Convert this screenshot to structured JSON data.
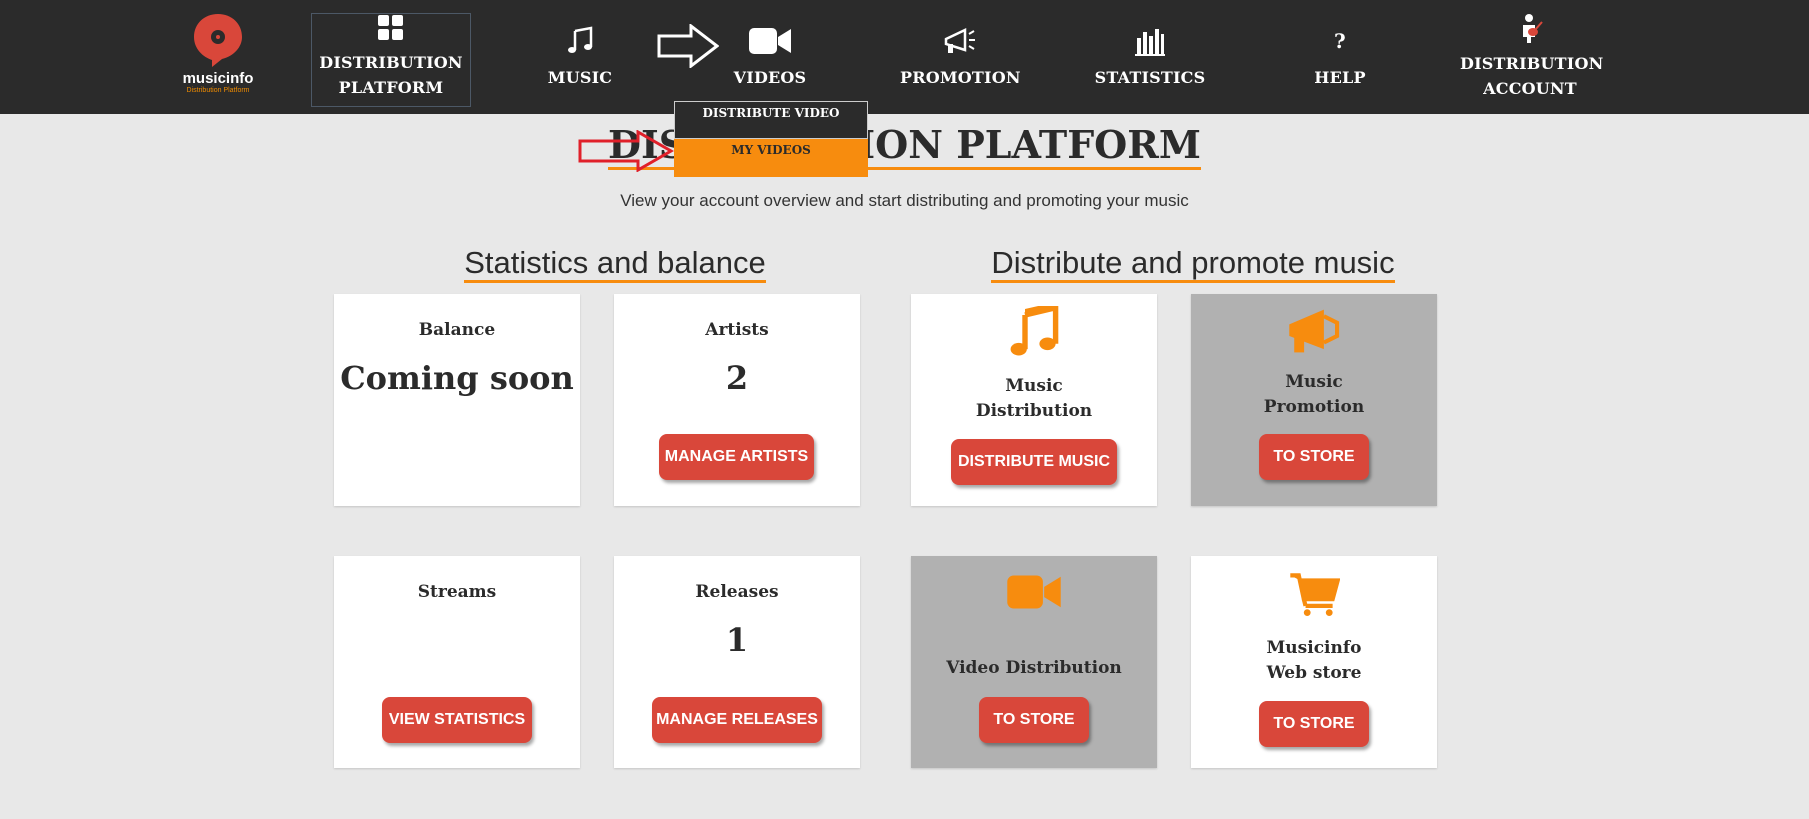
{
  "nav": {
    "brand": "musicinfo",
    "brand_sub": "Distribution Platform",
    "items": [
      {
        "line1": "DISTRIBUTION",
        "line2": "PLATFORM"
      },
      {
        "line1": "MUSIC",
        "line2": ""
      },
      {
        "line1": "VIDEOS",
        "line2": ""
      },
      {
        "line1": "PROMOTION",
        "line2": ""
      },
      {
        "line1": "STATISTICS",
        "line2": ""
      },
      {
        "line1": "HELP",
        "line2": ""
      },
      {
        "line1": "DISTRIBUTION",
        "line2": "ACCOUNT"
      }
    ],
    "help_glyph": "?"
  },
  "dropdown": {
    "items": [
      "DISTRIBUTE VIDEO",
      "MY VIDEOS"
    ]
  },
  "page": {
    "title": "DISTRIBUTION PLATFORM",
    "subtitle": "View your account overview and start distributing and promoting your music"
  },
  "sections": {
    "left": "Statistics and balance",
    "right": "Distribute and promote music"
  },
  "cards": {
    "balance": {
      "title": "Balance",
      "value": "Coming soon"
    },
    "artists": {
      "title": "Artists",
      "value": "2",
      "button": "MANAGE ARTISTS"
    },
    "music_distribution": {
      "title1": "Music",
      "title2": "Distribution",
      "button": "DISTRIBUTE MUSIC"
    },
    "music_promotion": {
      "title1": "Music",
      "title2": "Promotion",
      "button": "TO STORE"
    },
    "streams": {
      "title": "Streams",
      "button": "VIEW STATISTICS"
    },
    "releases": {
      "title": "Releases",
      "value": "1",
      "button": "MANAGE RELEASES"
    },
    "video_distribution": {
      "title": "Video Distribution",
      "button": "TO STORE"
    },
    "web_store": {
      "title1": "Musicinfo",
      "title2": "Web store",
      "button": "TO STORE"
    }
  },
  "colors": {
    "nav_bg": "#2b2b2b",
    "accent_orange": "#f78c0e",
    "button_red": "#d9473a",
    "page_bg": "#e8e8e8",
    "card_gray": "#b1b1b1",
    "annotation_red": "#e0202a"
  }
}
